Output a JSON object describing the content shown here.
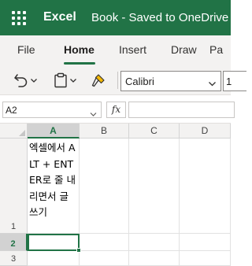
{
  "titlebar": {
    "app_name": "Excel",
    "doc_title": "Book  -  Saved to OneDrive",
    "bg_color": "#217346"
  },
  "ribbon_tabs": {
    "items": [
      {
        "label": "File"
      },
      {
        "label": "Home"
      },
      {
        "label": "Insert"
      },
      {
        "label": "Draw"
      },
      {
        "label": "Pa"
      }
    ],
    "active": "Home"
  },
  "toolbar": {
    "undo_icon": "undo-icon",
    "paste_icon": "clipboard-icon",
    "format_painter_icon": "paintbrush-icon",
    "font_name": "Calibri",
    "font_size": "1"
  },
  "formula_bar": {
    "name_box": "A2",
    "fx_label": "fx",
    "formula_value": ""
  },
  "sheet": {
    "columns": [
      "A",
      "B",
      "C",
      "D"
    ],
    "rows": [
      "1",
      "2",
      "3"
    ],
    "selected_cell": "A2",
    "cells": {
      "A1": "엑셀에서 ALT + ENTER로 줄 내리면서 글 쓰기"
    },
    "accent_color": "#217346"
  }
}
